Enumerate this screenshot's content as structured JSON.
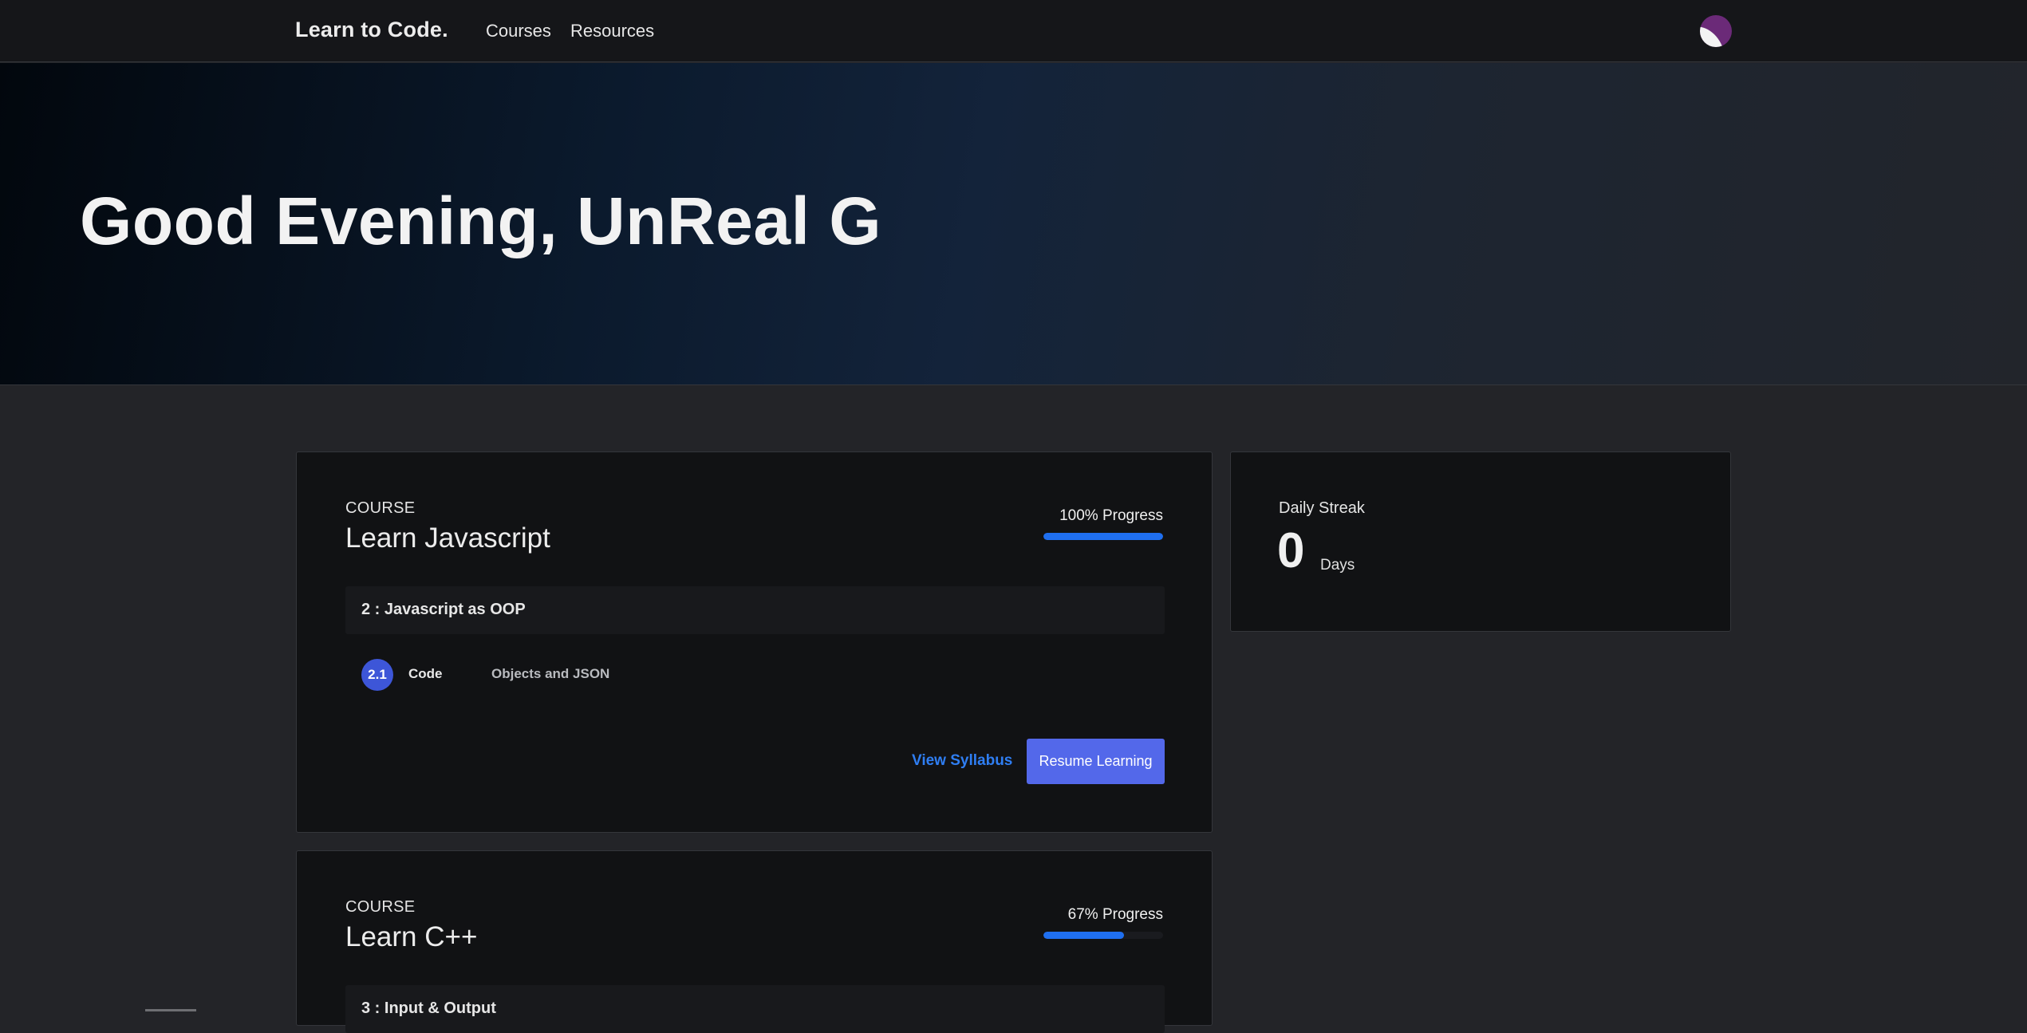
{
  "nav": {
    "brand": "Learn to Code.",
    "links": [
      "Courses",
      "Resources"
    ]
  },
  "hero": {
    "greeting": "Good Evening, UnReal G"
  },
  "courses": [
    {
      "eyebrow": "COURSE",
      "title": "Learn Javascript",
      "progress_label": "100% Progress",
      "progress_percent": 100,
      "module": "2 : Javascript as OOP",
      "lesson": {
        "number": "2.1",
        "type": "Code",
        "name": "Objects and JSON"
      },
      "syllabus_label": "View Syllabus",
      "resume_label": "Resume Learning"
    },
    {
      "eyebrow": "COURSE",
      "title": "Learn C++",
      "progress_label": "67% Progress",
      "progress_percent": 67,
      "module": "3 : Input & Output"
    }
  ],
  "streak": {
    "label": "Daily Streak",
    "count": "0",
    "unit": "Days"
  },
  "colors": {
    "accent_blue": "#1f6ff0",
    "button_indigo": "#5368ea",
    "link_blue": "#2f7ef3",
    "badge_blue": "#3d56d8"
  }
}
